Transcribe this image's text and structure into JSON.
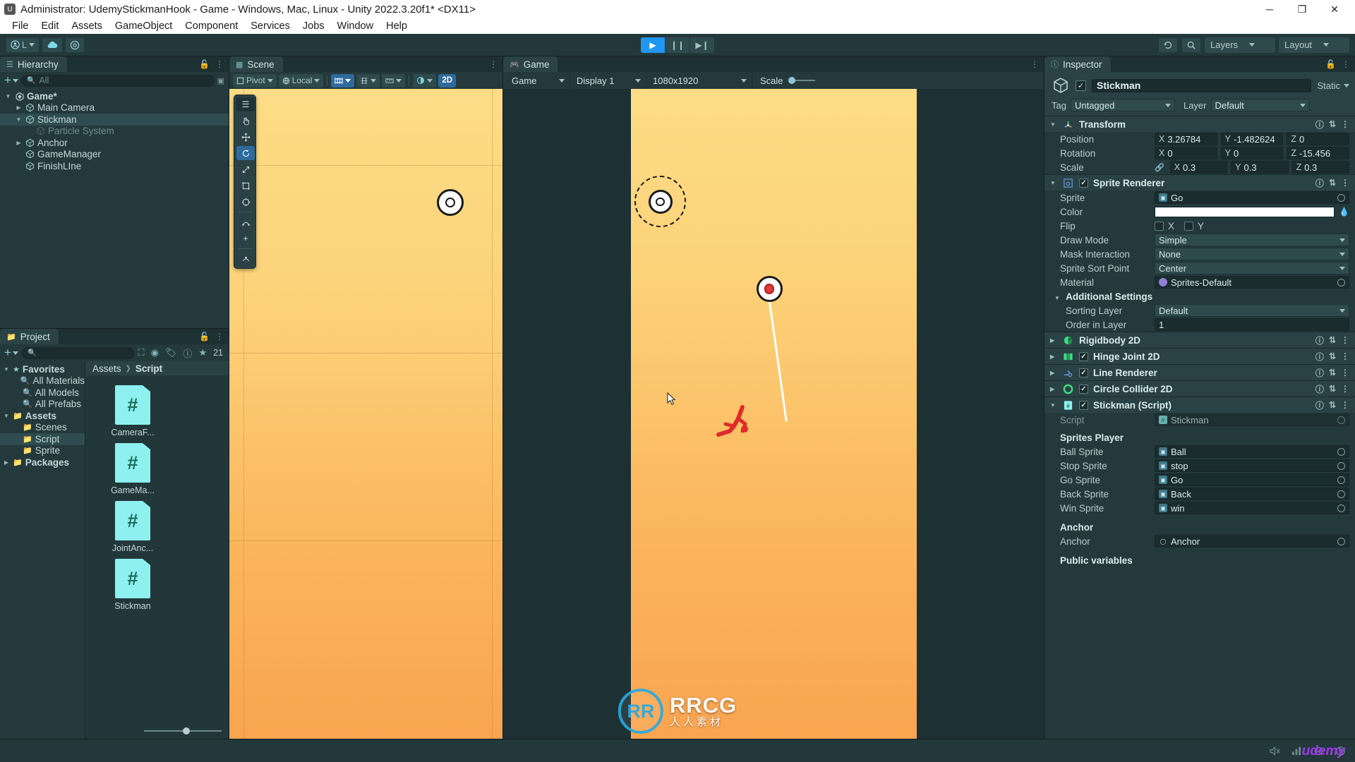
{
  "window": {
    "title": "Administrator: UdemyStickmanHook - Game - Windows, Mac, Linux - Unity 2022.3.20f1* <DX11>",
    "minimize": "─",
    "maximize": "❐",
    "close": "✕"
  },
  "menu": [
    "File",
    "Edit",
    "Assets",
    "GameObject",
    "Component",
    "Services",
    "Jobs",
    "Window",
    "Help"
  ],
  "toolbar": {
    "account_label": "L",
    "play": "▶",
    "pause": "❙❙",
    "step": "▶❙",
    "undo_history": "history-icon",
    "search": "search-icon",
    "layers_label": "Layers",
    "layout_label": "Layout"
  },
  "hierarchy": {
    "tab_label": "Hierarchy",
    "search_placeholder": "All",
    "items": [
      {
        "label": "Game*",
        "depth": 0,
        "expanded": true,
        "type": "scene",
        "selected": false,
        "dim": false
      },
      {
        "label": "Main Camera",
        "depth": 1,
        "expanded": false,
        "type": "go",
        "selected": false,
        "dim": false
      },
      {
        "label": "Stickman",
        "depth": 1,
        "expanded": true,
        "type": "go",
        "selected": true,
        "dim": false
      },
      {
        "label": "Particle System",
        "depth": 2,
        "expanded": null,
        "type": "go",
        "selected": false,
        "dim": true
      },
      {
        "label": "Anchor",
        "depth": 1,
        "expanded": false,
        "type": "go",
        "selected": false,
        "dim": false
      },
      {
        "label": "GameManager",
        "depth": 1,
        "expanded": null,
        "type": "go",
        "selected": false,
        "dim": false
      },
      {
        "label": "FinishLIne",
        "depth": 1,
        "expanded": null,
        "type": "go",
        "selected": false,
        "dim": false
      }
    ]
  },
  "project": {
    "tab_label": "Project",
    "search_placeholder": "",
    "count_badge": "21",
    "breadcrumb": [
      "Assets",
      "Script"
    ],
    "tree": [
      {
        "label": "Favorites",
        "depth": 0,
        "kind": "star",
        "expanded": true,
        "selected": false
      },
      {
        "label": "All Materials",
        "depth": 1,
        "kind": "search",
        "expanded": null,
        "selected": false
      },
      {
        "label": "All Models",
        "depth": 1,
        "kind": "search",
        "expanded": null,
        "selected": false
      },
      {
        "label": "All Prefabs",
        "depth": 1,
        "kind": "search",
        "expanded": null,
        "selected": false
      },
      {
        "label": "Assets",
        "depth": 0,
        "kind": "folder",
        "expanded": true,
        "selected": false
      },
      {
        "label": "Scenes",
        "depth": 1,
        "kind": "folder",
        "expanded": null,
        "selected": false
      },
      {
        "label": "Script",
        "depth": 1,
        "kind": "folder",
        "expanded": null,
        "selected": true
      },
      {
        "label": "Sprite",
        "depth": 1,
        "kind": "folder",
        "expanded": null,
        "selected": false
      },
      {
        "label": "Packages",
        "depth": 0,
        "kind": "folder",
        "expanded": false,
        "selected": false
      }
    ],
    "assets": [
      {
        "label": "CameraF...",
        "icon": "csharp-script-icon",
        "glyph": "#"
      },
      {
        "label": "GameMa...",
        "icon": "csharp-script-icon",
        "glyph": "#"
      },
      {
        "label": "JointAnc...",
        "icon": "csharp-script-icon",
        "glyph": "#"
      },
      {
        "label": "Stickman",
        "icon": "csharp-script-icon",
        "glyph": "#"
      }
    ]
  },
  "scene_view": {
    "tab_label": "Scene",
    "pivot_label": "Pivot",
    "local_label": "Local",
    "mode_2d": "2D",
    "tools": [
      "hand-tool",
      "move-tool",
      "rotate-tool",
      "scale-tool",
      "rect-tool",
      "transform-tool",
      "custom-tool-a",
      "add-tool",
      "custom-tool-b"
    ]
  },
  "game_view": {
    "tab_label": "Game",
    "aspect_label": "Game",
    "display_label": "Display 1",
    "resolution_label": "1080x1920",
    "scale_label": "Scale"
  },
  "inspector": {
    "tab_label": "Inspector",
    "object_name": "Stickman",
    "enabled": true,
    "static_label": "Static",
    "tag_label": "Tag",
    "tag_value": "Untagged",
    "layer_label": "Layer",
    "layer_value": "Default",
    "transform": {
      "title": "Transform",
      "rows": [
        {
          "label": "Position",
          "x": "3.26784",
          "y": "-1.482624",
          "z": "0"
        },
        {
          "label": "Rotation",
          "x": "0",
          "y": "0",
          "z": "-15.456"
        },
        {
          "label": "Scale",
          "x": "0.3",
          "y": "0.3",
          "z": "0.3"
        }
      ]
    },
    "sprite_renderer": {
      "title": "Sprite Renderer",
      "enabled": true,
      "sprite_label": "Sprite",
      "sprite_value": "Go",
      "color_label": "Color",
      "flip_label": "Flip",
      "flip_x": "X",
      "flip_y": "Y",
      "draw_mode_label": "Draw Mode",
      "draw_mode_value": "Simple",
      "mask_interaction_label": "Mask Interaction",
      "mask_interaction_value": "None",
      "sprite_sort_point_label": "Sprite Sort Point",
      "sprite_sort_point_value": "Center",
      "material_label": "Material",
      "material_value": "Sprites-Default",
      "additional_settings_label": "Additional Settings",
      "sorting_layer_label": "Sorting Layer",
      "sorting_layer_value": "Default",
      "order_in_layer_label": "Order in Layer",
      "order_in_layer_value": "1"
    },
    "components": [
      {
        "title": "Rigidbody 2D",
        "icon": "rigidbody2d-icon",
        "has_checkbox": false,
        "enabled": false
      },
      {
        "title": "Hinge Joint 2D",
        "icon": "hingejoint2d-icon",
        "has_checkbox": true,
        "enabled": true
      },
      {
        "title": "Line Renderer",
        "icon": "linerenderer-icon",
        "has_checkbox": true,
        "enabled": true
      },
      {
        "title": "Circle Collider 2D",
        "icon": "circlecollider2d-icon",
        "has_checkbox": true,
        "enabled": true
      }
    ],
    "script_component": {
      "title": "Stickman (Script)",
      "enabled": true,
      "script_label": "Script",
      "script_value": "Stickman",
      "sprites_player_header": "Sprites Player",
      "sprite_fields": [
        {
          "label": "Ball Sprite",
          "value": "Ball"
        },
        {
          "label": "Stop Sprite",
          "value": "stop"
        },
        {
          "label": "Go Sprite",
          "value": "Go"
        },
        {
          "label": "Back Sprite",
          "value": "Back"
        },
        {
          "label": "Win Sprite",
          "value": "win"
        }
      ],
      "anchor_header": "Anchor",
      "anchor_label": "Anchor",
      "anchor_value": "Anchor",
      "public_variables_header": "Public variables"
    }
  },
  "watermark": {
    "logo_text": "RR",
    "title": "RRCG",
    "subtitle": "人人素材"
  },
  "statusbar": {
    "udemy_label": "udemy",
    "icons": [
      "mute-icon",
      "stats-icon",
      "gizmos-icon",
      "help-icon"
    ]
  },
  "colors": {
    "accent_blue": "#2f6a9e",
    "panel_bg": "#24393c",
    "panel_header": "#2a4246",
    "selected_row": "#2f4c50",
    "text": "#b8cdcd",
    "green_icon": "#3ddc84",
    "scene_top": "#fcdd86",
    "scene_bottom": "#f9a450",
    "udemy_purple": "#a435f0"
  }
}
